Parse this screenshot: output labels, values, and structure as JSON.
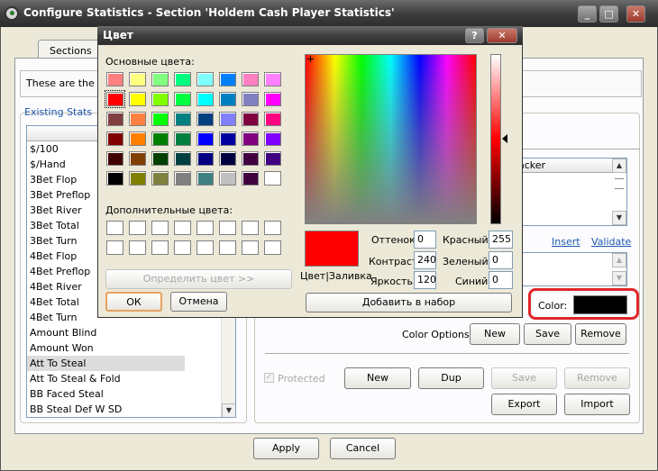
{
  "window": {
    "title": "Configure Statistics - Section 'Holdem Cash Player Statistics'"
  },
  "tabs": [
    {
      "label": "Sections"
    }
  ],
  "info_text": "These are the st",
  "existing_label": "Existing Stats",
  "stat_list": {
    "header": "Stat",
    "rows": [
      "$/100",
      "$/Hand",
      "3Bet Flop",
      "3Bet Preflop",
      "3Bet River",
      "3Bet Total",
      "3Bet Turn",
      "4Bet Flop",
      "4Bet Preflop",
      "4Bet River",
      "4Bet Total",
      "4Bet Turn",
      "Amount Blind",
      "Amount Won",
      "Att To Steal",
      "Att To Steal & Fold",
      "BB Faced Steal",
      "BB Steal Def W SD"
    ],
    "selected_index": 14
  },
  "right": {
    "column_header_partial": "acker",
    "insert_label": "Insert",
    "validate_label": "Validate",
    "color_label": "Color:",
    "color_value_hex": "#000000",
    "color_options_label": "Color Options:",
    "new_label": "New",
    "save_label": "Save",
    "remove_label": "Remove",
    "protected_label": "Protected",
    "new2_label": "New",
    "dup_label": "Dup",
    "save2_label": "Save",
    "remove2_label": "Remove",
    "export_label": "Export",
    "import_label": "Import"
  },
  "footer": {
    "apply_label": "Apply",
    "cancel_label": "Cancel"
  },
  "dialog": {
    "title": "Цвет",
    "basic_colors_label": "Основные цвета:",
    "custom_colors_label": "Дополнительные цвета:",
    "define_button": "Определить цвет >>",
    "ok_button": "ОК",
    "cancel_button": "Отмена",
    "add_button": "Добавить в набор",
    "preview_label": "Цвет|Заливка",
    "hue_label": "Оттенок:",
    "hue_value": "0",
    "sat_label": "Контраст:",
    "sat_value": "240",
    "lum_label": "Яркость:",
    "lum_value": "120",
    "red_label": "Красный:",
    "red_value": "255",
    "green_label": "Зеленый:",
    "green_value": "0",
    "blue_label": "Синий:",
    "blue_value": "0",
    "basic_colors": [
      [
        "#ff8080",
        "#ffff80",
        "#80ff80",
        "#00ff80",
        "#80ffff",
        "#0080ff",
        "#ff80c0",
        "#ff80ff"
      ],
      [
        "#ff0000",
        "#ffff00",
        "#80ff00",
        "#00ff40",
        "#00ffff",
        "#0080c0",
        "#8080c0",
        "#ff00ff"
      ],
      [
        "#804040",
        "#ff8040",
        "#00ff00",
        "#008080",
        "#004080",
        "#8080ff",
        "#800040",
        "#ff0080"
      ],
      [
        "#800000",
        "#ff8000",
        "#008000",
        "#008040",
        "#0000ff",
        "#0000a0",
        "#800080",
        "#8000ff"
      ],
      [
        "#400000",
        "#804000",
        "#004000",
        "#004040",
        "#000080",
        "#000040",
        "#400040",
        "#400080"
      ],
      [
        "#000000",
        "#808000",
        "#808040",
        "#808080",
        "#408080",
        "#c0c0c0",
        "#400040",
        "#ffffff"
      ]
    ],
    "selected_basic": [
      1,
      0
    ]
  }
}
